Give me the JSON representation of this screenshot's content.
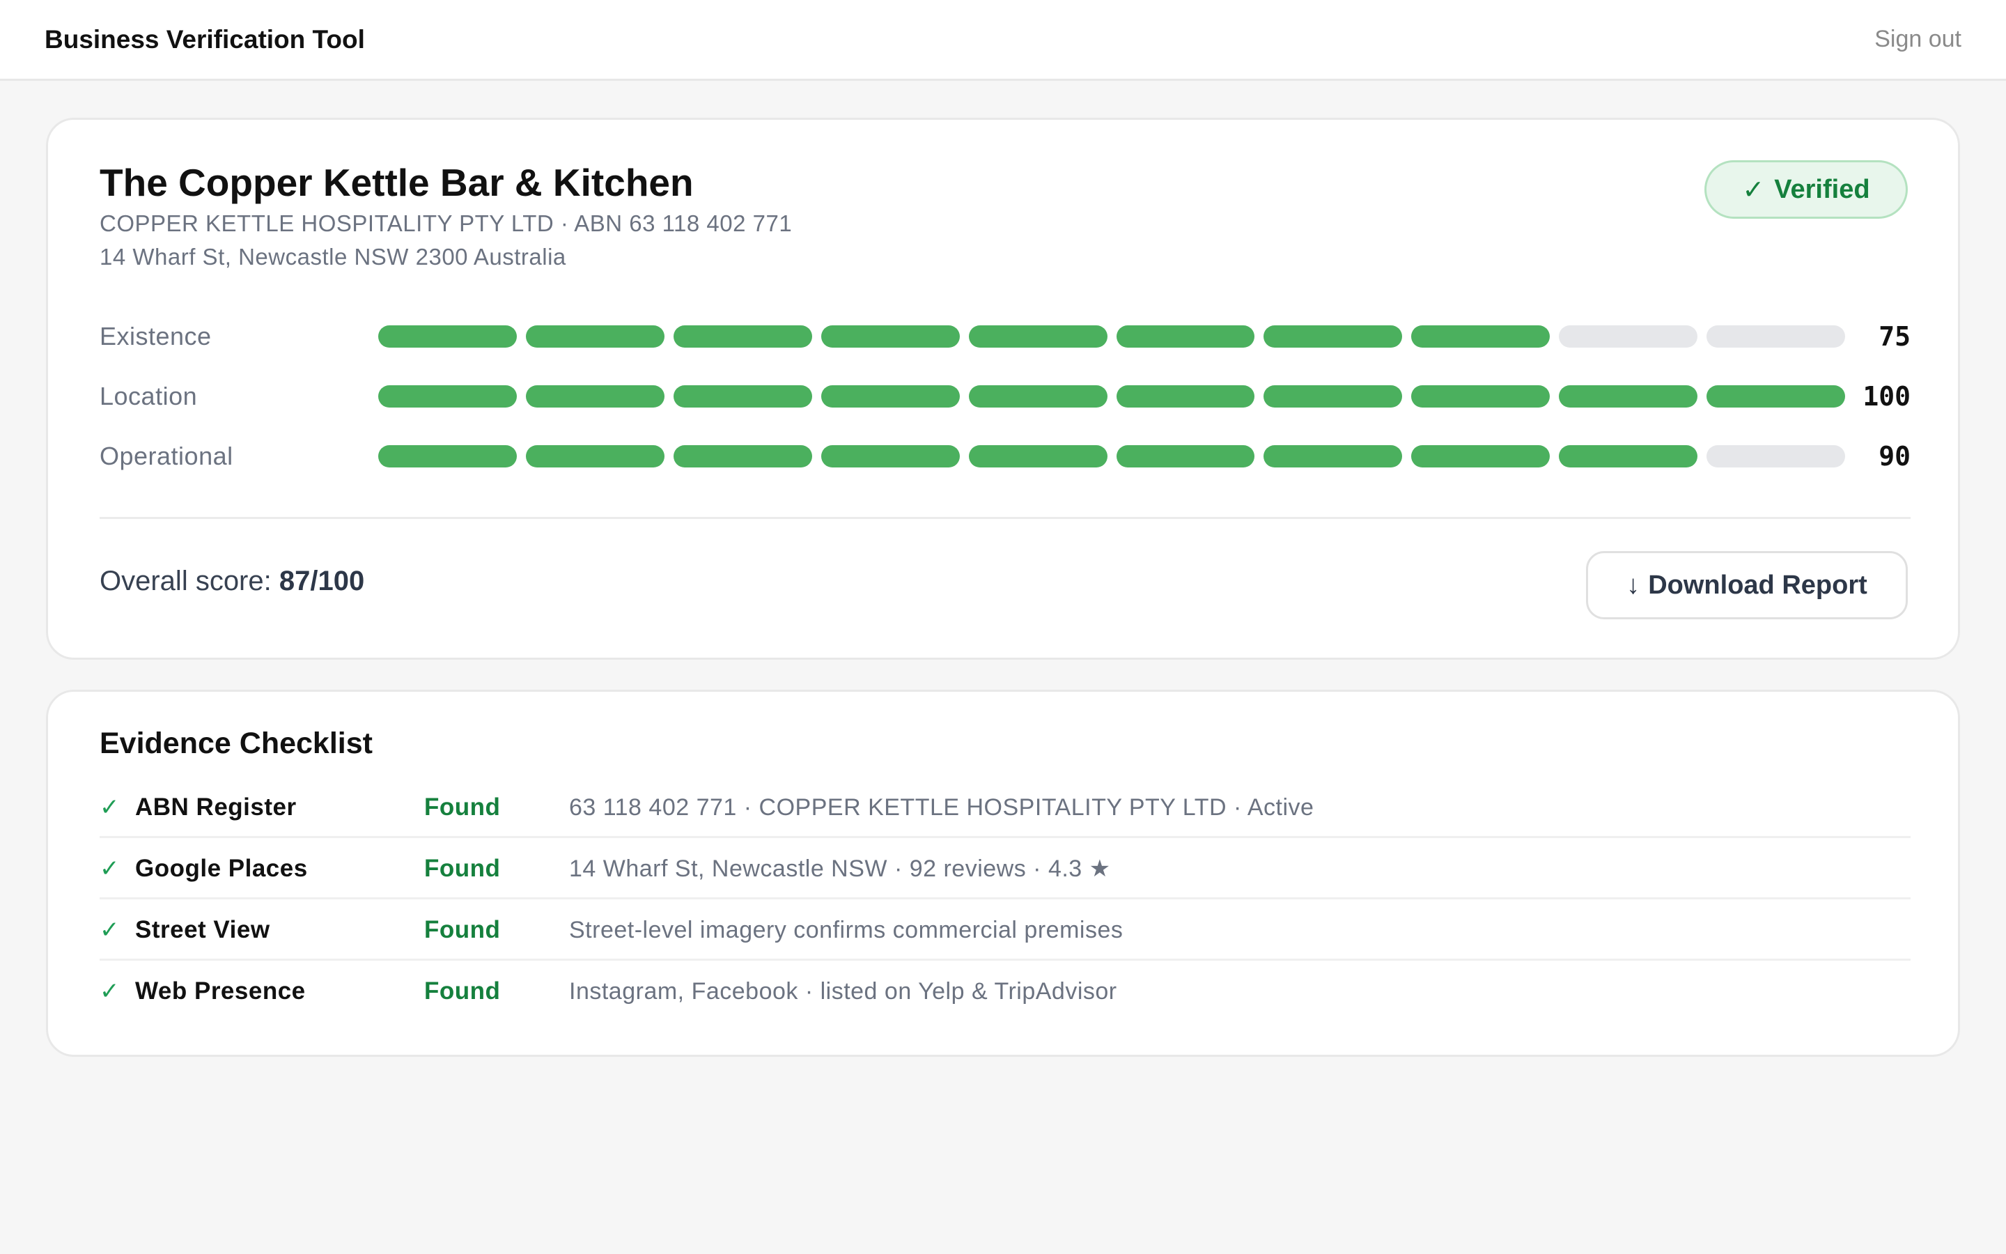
{
  "header": {
    "app_title": "Business Verification Tool",
    "signout_label": "Sign out"
  },
  "business": {
    "name": "The Copper Kettle Bar & Kitchen",
    "entity_line": "COPPER KETTLE HOSPITALITY PTY LTD · ABN 63 118 402 771",
    "address": "14 Wharf St, Newcastle NSW 2300 Australia"
  },
  "status_badge": {
    "icon": "check-icon",
    "check_glyph": "✓",
    "label": "Verified",
    "color": "#15803d"
  },
  "scores": [
    {
      "label": "Existence",
      "value": 75,
      "display": "75"
    },
    {
      "label": "Location",
      "value": 100,
      "display": "100"
    },
    {
      "label": "Operational",
      "value": 90,
      "display": "90"
    }
  ],
  "score_colors": {
    "filled": "#4bb05e",
    "empty": "#e6e7ea"
  },
  "overall": {
    "label": "Overall score:",
    "value": "87/100"
  },
  "download": {
    "icon": "arrow-down-icon",
    "arrow_glyph": "↓",
    "label": "Download Report"
  },
  "evidence": {
    "title": "Evidence Checklist",
    "check_glyph": "✓",
    "items": [
      {
        "source": "ABN Register",
        "status": "Found",
        "detail": "63 118 402 771 · COPPER KETTLE HOSPITALITY PTY LTD · Active"
      },
      {
        "source": "Google Places",
        "status": "Found",
        "detail": "14 Wharf St, Newcastle NSW · 92 reviews · 4.3 ★"
      },
      {
        "source": "Street View",
        "status": "Found",
        "detail": "Street-level imagery confirms commercial premises"
      },
      {
        "source": "Web Presence",
        "status": "Found",
        "detail": "Instagram, Facebook · listed on Yelp & TripAdvisor"
      }
    ]
  }
}
